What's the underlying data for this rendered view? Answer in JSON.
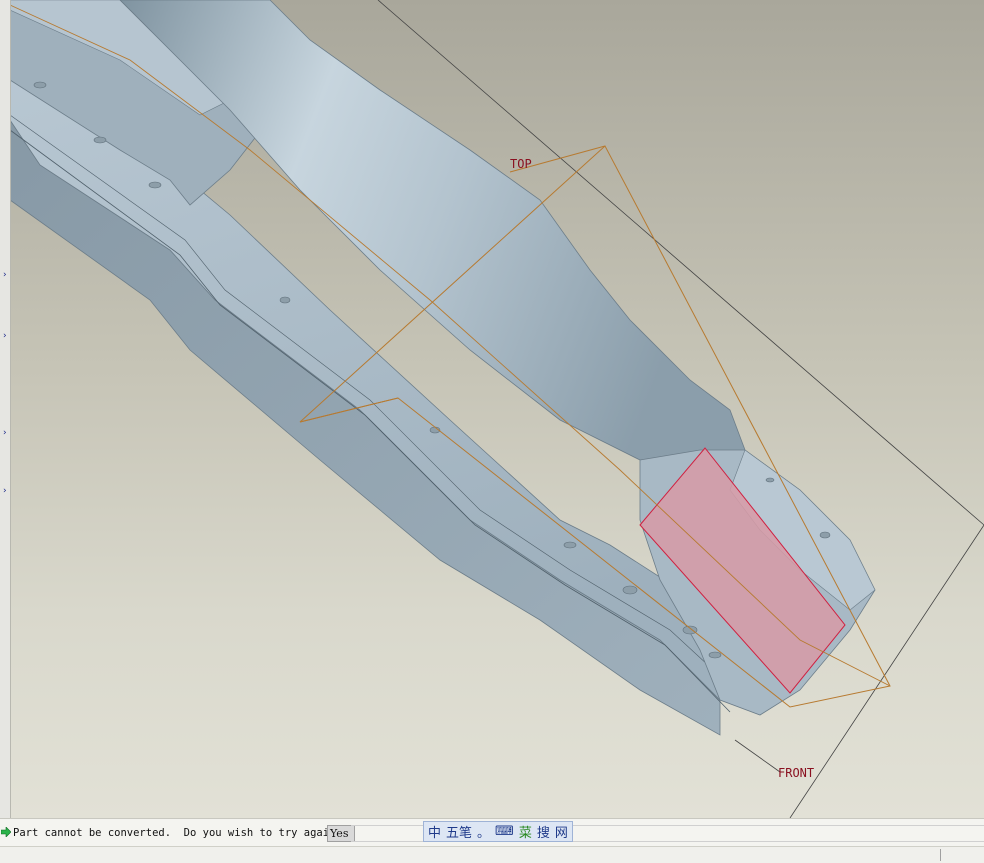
{
  "viewport": {
    "datum_top_label": "TOP",
    "datum_front_label": "FRONT"
  },
  "message_bar": {
    "prompt_text": "Part cannot be converted.  Do you wish to try again?",
    "answer_value": "Yes"
  },
  "ime_toolbar": {
    "items": [
      "中",
      "五笔",
      "。",
      "⌨",
      "菜",
      "搜",
      "网"
    ]
  },
  "icons": {
    "prompt_arrow": "green-arrow-icon"
  },
  "colors": {
    "part_surface": "#aebfca",
    "datum_plane": "#b77a30",
    "highlight_face": "#d79aa6",
    "datum_label": "#8a1020"
  }
}
